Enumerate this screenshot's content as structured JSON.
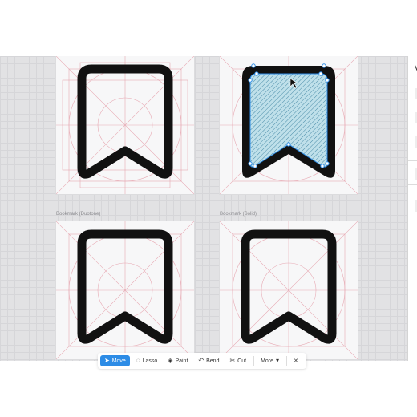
{
  "panel": {
    "title": "V"
  },
  "artboards": [
    {
      "caption": "",
      "variant": "outline"
    },
    {
      "caption": "",
      "variant": "selected"
    },
    {
      "caption": "Bookmark (Duotone)",
      "variant": "outline"
    },
    {
      "caption": "Bookmark (Solid)",
      "variant": "outline"
    }
  ],
  "toolbar": {
    "move_label": "Move",
    "lasso_label": "Lasso",
    "paint_label": "Paint",
    "bend_label": "Bend",
    "cut_label": "Cut",
    "more_label": "More",
    "close_label": "✕"
  },
  "colors": {
    "workspace": "#e2e2e4",
    "stroke": "#111111",
    "guide": "#e7a9b3",
    "fill_hatch": "#bfe0ea",
    "selection": "#2d8ce6"
  }
}
